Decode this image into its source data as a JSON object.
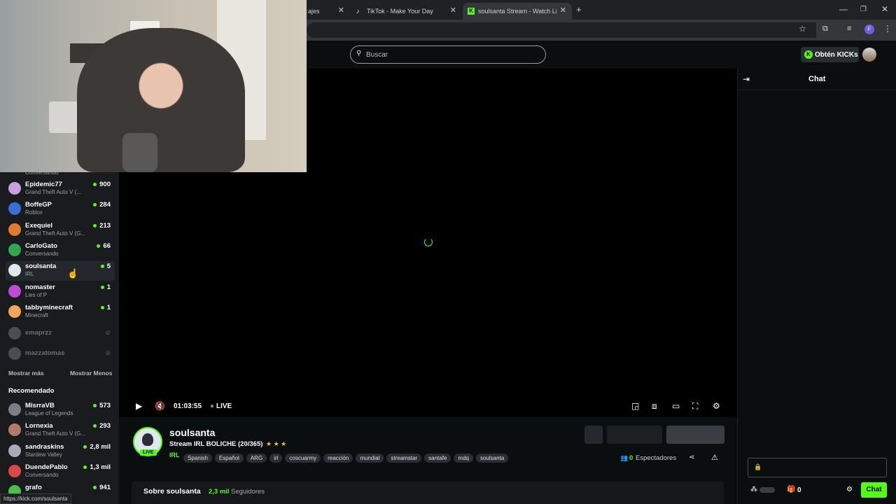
{
  "browser": {
    "tabs": [
      {
        "label": "ajes"
      },
      {
        "label": "TikTok - Make Your Day"
      },
      {
        "label": "soulsanta Stream - Watch Live o"
      }
    ],
    "new_tab": "+",
    "profile_initial": "F",
    "status_url": "https://kick.com/soulsanta"
  },
  "header": {
    "search_placeholder": "Buscar",
    "kicks_label": "Obtén KICKs"
  },
  "sidebar": {
    "partial_item": "Conversando",
    "following": [
      {
        "name": "Epidemic77",
        "category": "Grand Theft Auto V (...",
        "viewers": "900",
        "avatar_color": "#c9a0dc"
      },
      {
        "name": "BoffeGP",
        "category": "Roblox",
        "viewers": "284",
        "avatar_color": "#3b6fd8"
      },
      {
        "name": "Exequiel",
        "category": "Grand Theft Auto V (G...",
        "viewers": "213",
        "avatar_color": "#e07a2e"
      },
      {
        "name": "CarloGato",
        "category": "Conversando",
        "viewers": "66",
        "avatar_color": "#2fa84f"
      },
      {
        "name": "soulsanta",
        "category": "IRL",
        "viewers": "5",
        "avatar_color": "#dfe7ef"
      },
      {
        "name": "nomaster",
        "category": "Lies of P",
        "viewers": "1",
        "avatar_color": "#c04ad8"
      },
      {
        "name": "tabbyminecraft",
        "category": "Minecraft",
        "viewers": "1",
        "avatar_color": "#f2a65a"
      }
    ],
    "offline": [
      {
        "name": "emaprzz"
      },
      {
        "name": "mazzatomas"
      }
    ],
    "show_more": "Mostrar más",
    "show_less": "Mostrar Menos",
    "recommended_title": "Recomendado",
    "recommended": [
      {
        "name": "MisrraVB",
        "category": "League of Legends",
        "viewers": "573",
        "avatar_color": "#7a7d86"
      },
      {
        "name": "Lornexia",
        "category": "Grand Theft Auto V (G...",
        "viewers": "293",
        "avatar_color": "#b07a68"
      },
      {
        "name": "sandraskins",
        "category": "Stardew Valley",
        "viewers": "2,8 mil",
        "avatar_color": "#a8a8b8"
      },
      {
        "name": "DuendePablo",
        "category": "Conversando",
        "viewers": "1,3 mil",
        "avatar_color": "#d84a4a"
      },
      {
        "name": "grafo",
        "category": "",
        "viewers": "941",
        "avatar_color": "#4ac04a"
      }
    ]
  },
  "player": {
    "time": "01:03:55",
    "live_label": "LIVE"
  },
  "stream": {
    "channel_name": "soulsanta",
    "title": "Stream IRL BOLICHE (20/365)",
    "stars": "★ ★ ★",
    "live_badge": "LIVE",
    "category": "IRL",
    "tags": [
      "Spanish",
      "Español",
      "ARG",
      "irl",
      "coscuarmy",
      "reacción",
      "mundial",
      "streamstar",
      "santafe",
      "mdq",
      "soulsanta"
    ],
    "viewers_count": "0",
    "viewers_label": "Espectadores",
    "about_title": "Sobre soulsanta",
    "followers_count": "2,3 mil",
    "followers_label": "Seguidores"
  },
  "chat": {
    "title": "Chat",
    "gift_count": "0",
    "send_label": "Chat"
  },
  "colors": {
    "accent": "#53fc18",
    "background": "#0b0e0f",
    "sidebar": "#191b1f"
  }
}
